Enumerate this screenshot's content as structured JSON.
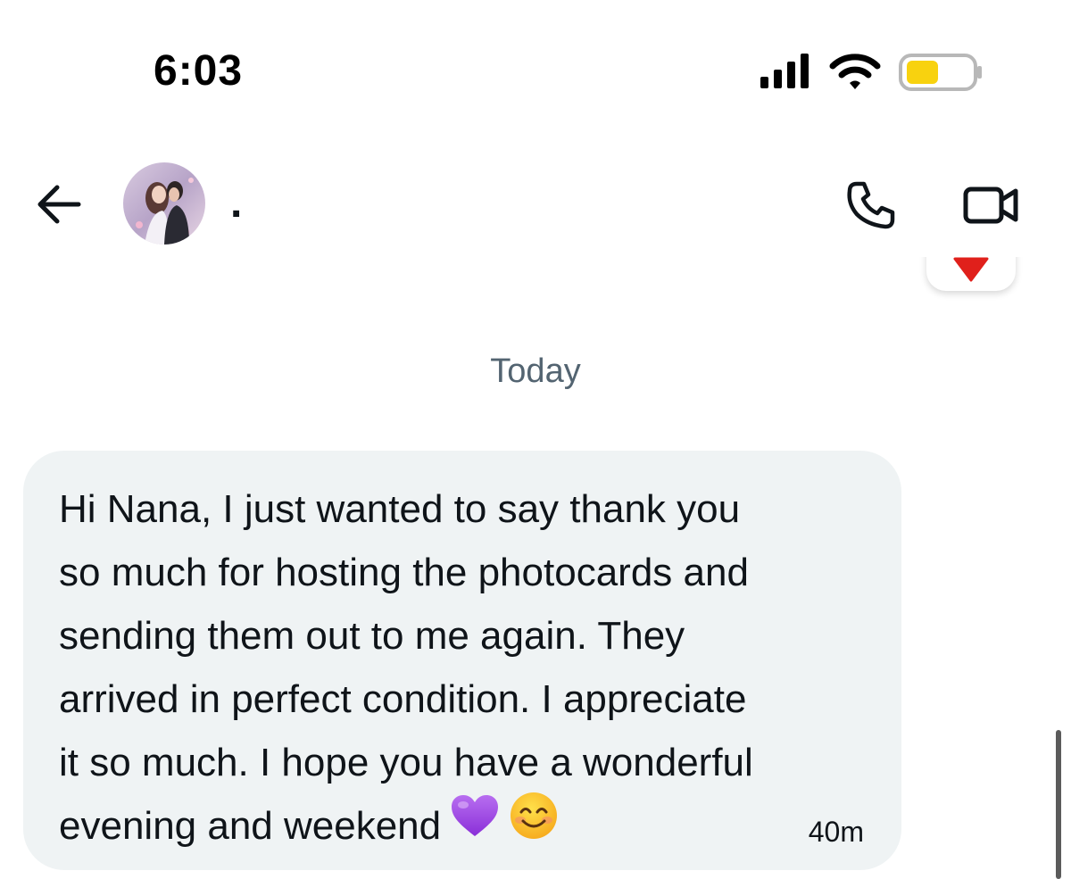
{
  "status_bar": {
    "time": "6:03",
    "battery_color": "#f8d20f"
  },
  "header": {
    "contact_name": ".",
    "icons": {
      "back": "back-arrow-icon",
      "call": "phone-icon",
      "video": "video-camera-icon"
    }
  },
  "scroll_button": {
    "icon": "down-arrow-icon",
    "color": "#e0201b"
  },
  "conversation": {
    "date_divider": "Today",
    "messages": [
      {
        "text": "Hi Nana, I just wanted to say thank you\nso much for hosting the photocards and\nsending them out to me again. They\narrived in perfect condition. I appreciate\nit so much. I hope you have a wonderful\nevening and weekend",
        "emojis": [
          "purple-heart-emoji",
          "smiling-face-emoji"
        ],
        "timestamp": "40m"
      }
    ]
  }
}
